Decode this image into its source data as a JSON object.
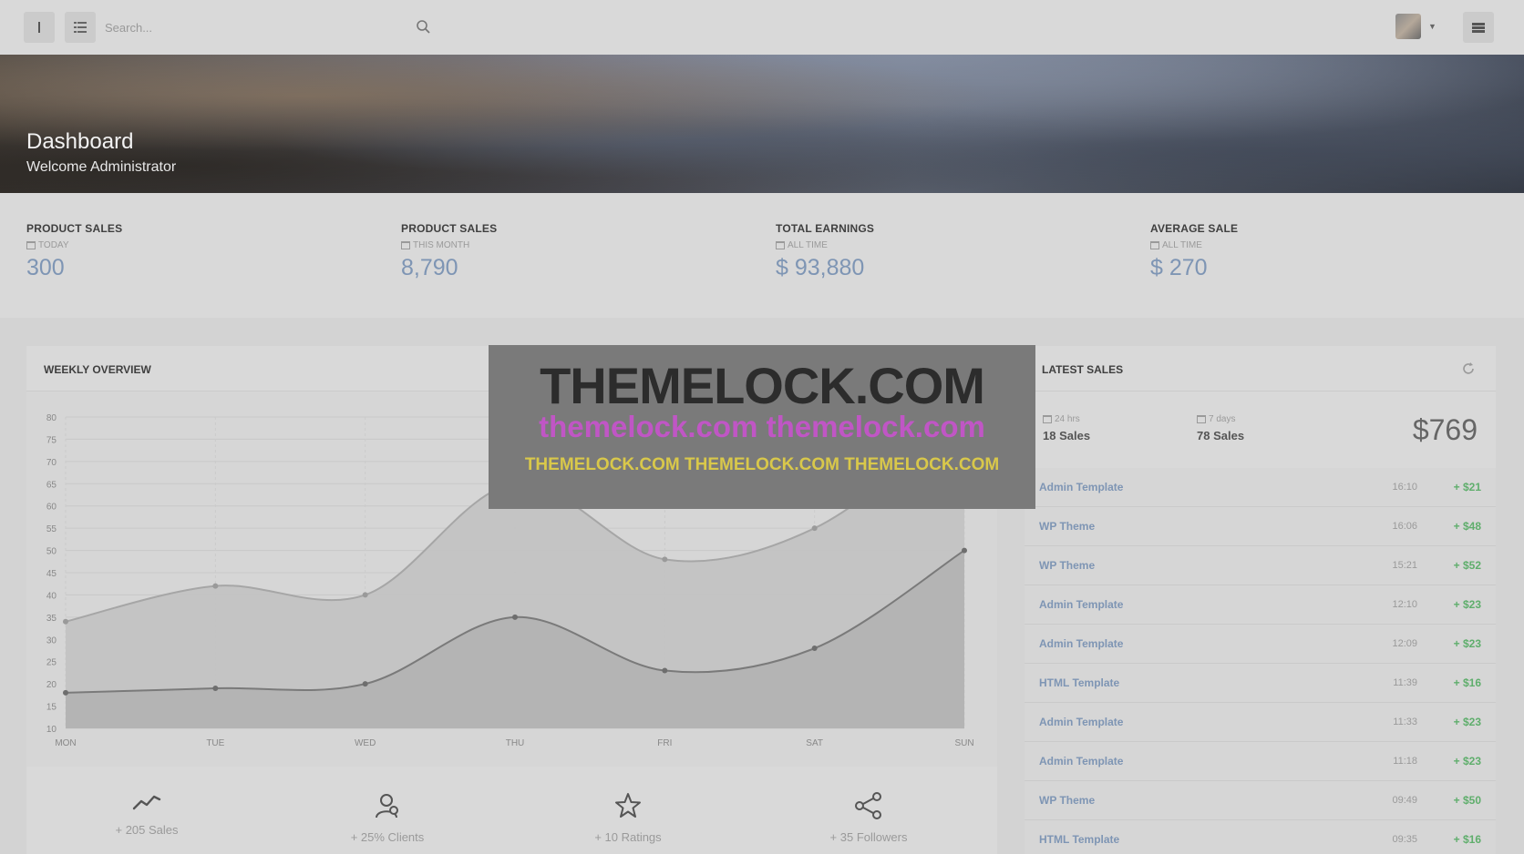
{
  "topbar": {
    "search_placeholder": "Search..."
  },
  "banner": {
    "title": "Dashboard",
    "subtitle": "Welcome Administrator"
  },
  "stats": [
    {
      "label": "PRODUCT SALES",
      "period": "TODAY",
      "value": "300"
    },
    {
      "label": "PRODUCT SALES",
      "period": "THIS MONTH",
      "value": "8,790"
    },
    {
      "label": "TOTAL EARNINGS",
      "period": "ALL TIME",
      "value": "$ 93,880"
    },
    {
      "label": "AVERAGE SALE",
      "period": "ALL TIME",
      "value": "$ 270"
    }
  ],
  "weekly": {
    "title": "WEEKLY OVERVIEW",
    "footer": [
      {
        "icon": "trend-line-icon",
        "label": "+ 205 Sales"
      },
      {
        "icon": "user-award-icon",
        "label": "+ 25% Clients"
      },
      {
        "icon": "star-icon",
        "label": "+ 10 Ratings"
      },
      {
        "icon": "share-icon",
        "label": "+ 35 Followers"
      }
    ]
  },
  "chart_data": {
    "type": "area",
    "x": [
      "MON",
      "TUE",
      "WED",
      "THU",
      "FRI",
      "SAT",
      "SUN"
    ],
    "y_ticks": [
      10,
      15,
      20,
      25,
      30,
      35,
      40,
      45,
      50,
      55,
      60,
      65,
      70,
      75,
      80
    ],
    "ylim": [
      10,
      80
    ],
    "grid": true,
    "series": [
      {
        "values": [
          34,
          42,
          40,
          65,
          48,
          55,
          80
        ]
      },
      {
        "values": [
          18,
          19,
          20,
          35,
          23,
          28,
          50
        ]
      }
    ]
  },
  "sales": {
    "title": "LATEST SALES",
    "summary": [
      {
        "period": "24 hrs",
        "count": "18 Sales"
      },
      {
        "period": "7 days",
        "count": "78 Sales"
      }
    ],
    "total": "$769",
    "rows": [
      {
        "name": "Admin Template",
        "time": "16:10",
        "amount": "+ $21"
      },
      {
        "name": "WP Theme",
        "time": "16:06",
        "amount": "+ $48"
      },
      {
        "name": "WP Theme",
        "time": "15:21",
        "amount": "+ $52"
      },
      {
        "name": "Admin Template",
        "time": "12:10",
        "amount": "+ $23"
      },
      {
        "name": "Admin Template",
        "time": "12:09",
        "amount": "+ $23"
      },
      {
        "name": "HTML Template",
        "time": "11:39",
        "amount": "+ $16"
      },
      {
        "name": "Admin Template",
        "time": "11:33",
        "amount": "+ $23"
      },
      {
        "name": "Admin Template",
        "time": "11:18",
        "amount": "+ $23"
      },
      {
        "name": "WP Theme",
        "time": "09:49",
        "amount": "+ $50"
      },
      {
        "name": "HTML Template",
        "time": "09:35",
        "amount": "+ $16"
      }
    ]
  },
  "watermark": {
    "line1": "THEMELOCK.COM",
    "line2": "themelock.com themelock.com",
    "line3": "THEMELOCK.COM THEMELOCK.COM THEMELOCK.COM"
  },
  "colors": {
    "accent_value": "#7e95b4",
    "positive": "#5fae6c",
    "watermark_magenta": "#c056c5",
    "watermark_yellow": "#d9c84a"
  }
}
